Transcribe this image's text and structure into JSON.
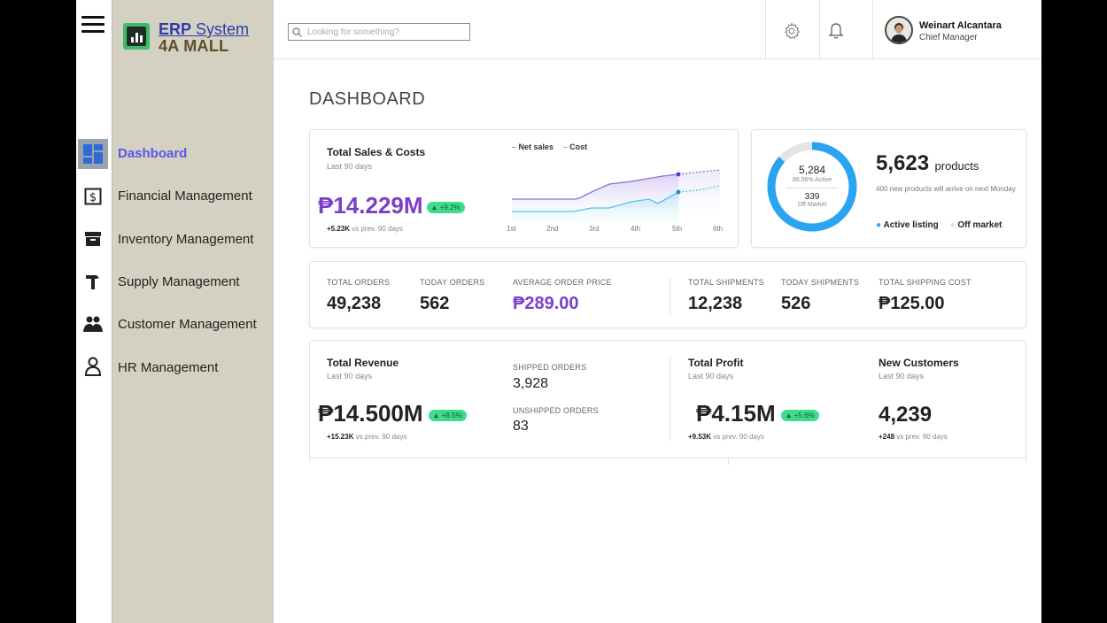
{
  "brand": {
    "title_bold": "ERP",
    "title_rest": " System",
    "subtitle": "4A MALL"
  },
  "nav": [
    {
      "label": "Dashboard",
      "icon": "dashboard-icon"
    },
    {
      "label": "Financial Management",
      "icon": "dollar-icon"
    },
    {
      "label": "Inventory Management",
      "icon": "archive-icon"
    },
    {
      "label": "Supply Management",
      "icon": "hammer-icon"
    },
    {
      "label": "Customer Management",
      "icon": "users-icon"
    },
    {
      "label": "HR Management",
      "icon": "person-icon"
    }
  ],
  "search": {
    "placeholder": "Looking for something?"
  },
  "user": {
    "name": "Weinart Alcantara",
    "role": "Chief Manager"
  },
  "page_title": "DASHBOARD",
  "sales": {
    "title": "Total Sales & Costs",
    "period": "Last 90 days",
    "value": "₱14.229M",
    "delta": "▲ +9.2%",
    "compare_bold": "+5.23K",
    "compare_rest": " vs prev. 90 days",
    "legend": [
      "Net sales",
      "Cost"
    ],
    "ticks": [
      "1st",
      "2nd",
      "3rd",
      "4th",
      "5th",
      "6th"
    ]
  },
  "products": {
    "active_count": "5,284",
    "active_pct": "86.56% Active",
    "off_count": "339",
    "off_label": "Off Market",
    "total": "5,623",
    "unit": "products",
    "note": "400 new products will arrive on next Monday",
    "legend_active": "Active listing",
    "legend_off": "Off market",
    "active_fraction": 0.8656
  },
  "kpis": [
    {
      "label": "TOTAL ORDERS",
      "value": "49,238"
    },
    {
      "label": "TODAY ORDERS",
      "value": "562"
    },
    {
      "label": "AVERAGE ORDER PRICE",
      "value": "₱289.00"
    },
    {
      "label": "TOTAL SHIPMENTS",
      "value": "12,238"
    },
    {
      "label": "TODAY SHIPMENTS",
      "value": "526"
    },
    {
      "label": "TOTAL SHIPPING COST",
      "value": "₱125.00"
    }
  ],
  "revenue": {
    "title": "Total Revenue",
    "period": "Last 90 days",
    "value": "₱14.500M",
    "delta": "▲ +8.5%",
    "compare_bold": "+15.23K",
    "compare_rest": " vs prev. 90 days"
  },
  "orders": {
    "shipped_label": "SHIPPED ORDERS",
    "shipped_value": "3,928",
    "unshipped_label": "UNSHIPPED ORDERS",
    "unshipped_value": "83"
  },
  "profit": {
    "title": "Total Profit",
    "period": "Last 90 days",
    "value": "₱4.15M",
    "delta": "▲ +5.6%",
    "compare_bold": "+9.53K",
    "compare_rest": " vs prev. 90 days"
  },
  "customers": {
    "title": "New Customers",
    "period": "Last 90 days",
    "value": "4,239",
    "compare_bold": "+248",
    "compare_rest": " vs prev. 90 days"
  },
  "colors": {
    "accent": "#5b55e8",
    "sidebar": "#d4d1c2",
    "net_sales": "#8e6fd6",
    "cost": "#4fc3e8",
    "delta_bg": "#3ddb8e",
    "donut": "#2aa3f0"
  }
}
